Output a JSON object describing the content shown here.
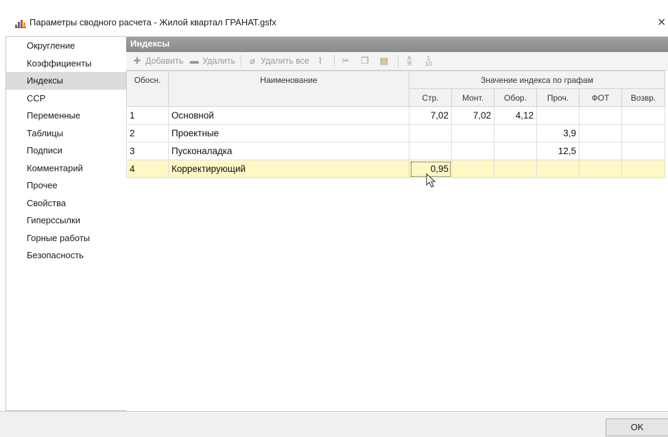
{
  "window": {
    "title": "Параметры сводного расчета - Жилой квартал ГРАНАТ.gsfx",
    "close_glyph": "×"
  },
  "sidebar": {
    "items": [
      {
        "label": "Округление"
      },
      {
        "label": "Коэффициенты"
      },
      {
        "label": "Индексы",
        "active": true
      },
      {
        "label": "ССР"
      },
      {
        "label": "Переменные"
      },
      {
        "label": "Таблицы"
      },
      {
        "label": "Подписи"
      },
      {
        "label": "Комментарий"
      },
      {
        "label": "Прочее"
      },
      {
        "label": "Свойства"
      },
      {
        "label": "Гиперссылки"
      },
      {
        "label": "Горные работы"
      },
      {
        "label": "Безопасность"
      }
    ]
  },
  "panel": {
    "title": "Индексы"
  },
  "toolbar": {
    "add_label": "Добавить",
    "delete_label": "Удалить",
    "delete_all_label": "Удалить все"
  },
  "table": {
    "headers": {
      "basis": "Обосн.",
      "name": "Наименование",
      "group": "Значение индекса по графам",
      "cols": [
        "Стр.",
        "Монт.",
        "Обор.",
        "Проч.",
        "ФОТ",
        "Возвр."
      ]
    },
    "rows": [
      {
        "basis": "1",
        "name": "Основной",
        "values": [
          "7,02",
          "7,02",
          "4,12",
          "",
          "",
          ""
        ]
      },
      {
        "basis": "2",
        "name": "Проектные",
        "values": [
          "",
          "",
          "",
          "3,9",
          "",
          ""
        ]
      },
      {
        "basis": "3",
        "name": "Пусконаладка",
        "values": [
          "",
          "",
          "",
          "12,5",
          "",
          ""
        ]
      },
      {
        "basis": "4",
        "name": "Корректирующий",
        "values": [
          "0,95",
          "",
          "",
          "",
          "",
          ""
        ],
        "selected": true
      }
    ]
  },
  "footer": {
    "ok_label": "OK"
  },
  "colors": {
    "selected_row": "#fdf8c6",
    "panel_header": "#8a8a8a",
    "sidebar_active": "#dcdcdc"
  }
}
